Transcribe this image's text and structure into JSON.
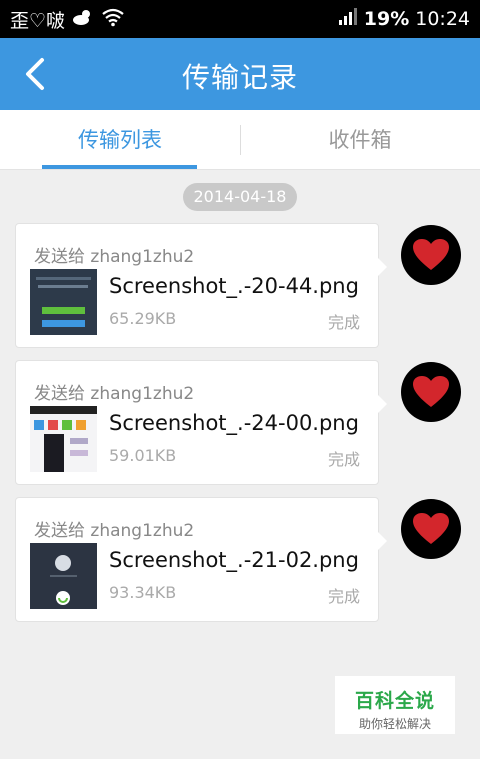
{
  "status_bar": {
    "left_text": "歪♡啵",
    "weather_icon": "cloud-sun-icon",
    "wifi_icon": "wifi-icon",
    "signal_icon": "signal-bars-icon",
    "battery": "19%",
    "time": "10:24"
  },
  "header": {
    "title": "传输记录",
    "back_icon": "back-arrow-icon"
  },
  "tabs": [
    {
      "label": "传输列表",
      "active": true
    },
    {
      "label": "收件箱",
      "active": false
    }
  ],
  "date": "2014-04-18",
  "records": [
    {
      "sender": "发送给 zhang1zhu2",
      "filename": "Screenshot_.-20-44.png",
      "size": "65.29KB",
      "status": "完成"
    },
    {
      "sender": "发送给 zhang1zhu2",
      "filename": "Screenshot_.-24-00.png",
      "size": "59.01KB",
      "status": "完成"
    },
    {
      "sender": "发送给 zhang1zhu2",
      "filename": "Screenshot_.-21-02.png",
      "size": "93.34KB",
      "status": "完成"
    }
  ],
  "watermark": {
    "title": "百科全说",
    "subtitle": "助你轻松解决"
  },
  "colors": {
    "accent": "#3d97e0",
    "heart": "#d3262c",
    "watermark_green": "#2ba84a"
  }
}
